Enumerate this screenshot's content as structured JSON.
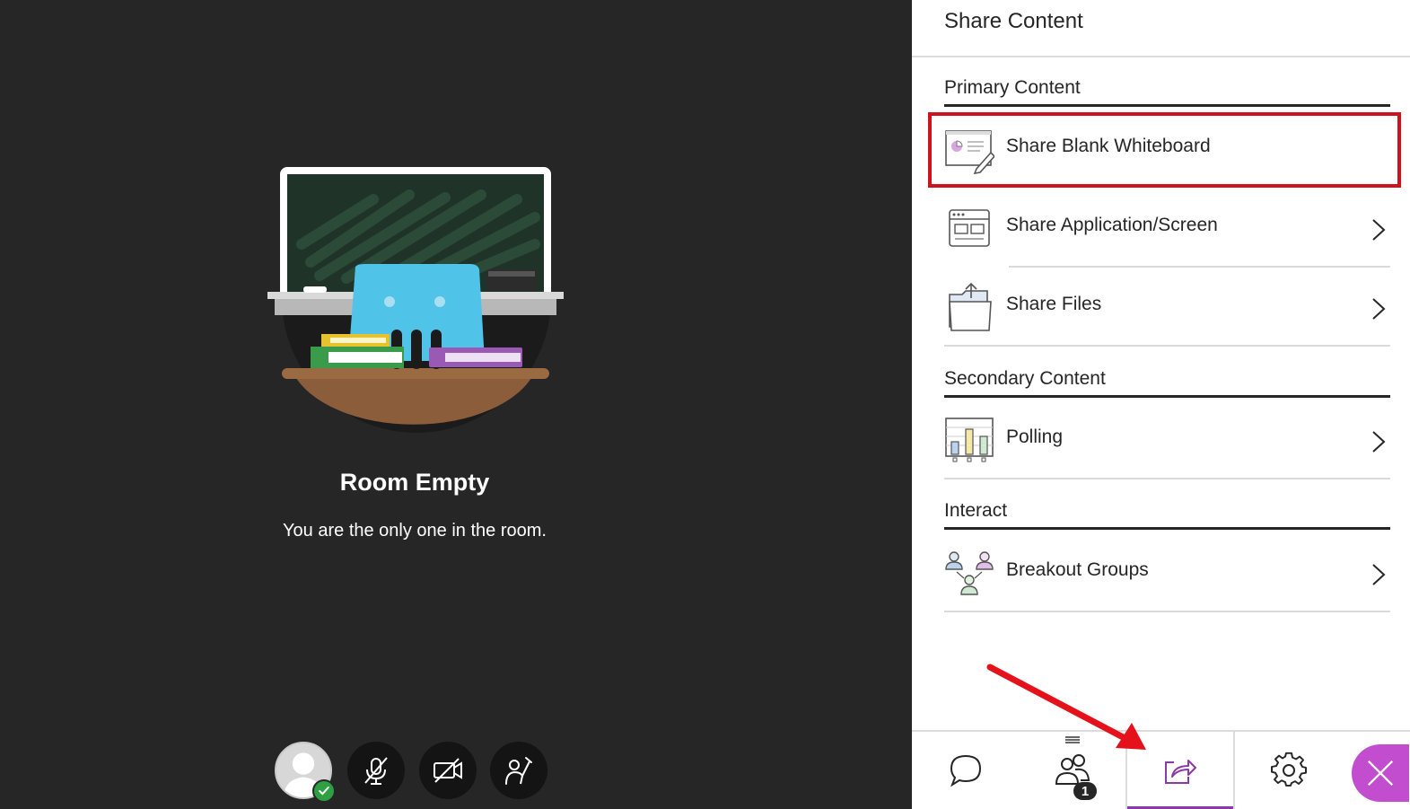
{
  "stage": {
    "title": "Room Empty",
    "subtitle": "You are the only one in the room.",
    "controls": [
      {
        "icon": "avatar-icon",
        "status": "check-icon"
      },
      {
        "icon": "microphone-muted-icon"
      },
      {
        "icon": "camera-off-icon"
      },
      {
        "icon": "raise-hand-icon"
      }
    ]
  },
  "panel": {
    "title": "Share Content",
    "sections": {
      "primary": {
        "heading": "Primary Content",
        "items": [
          {
            "label": "Share Blank Whiteboard",
            "icon": "whiteboard-icon",
            "chevron": false
          },
          {
            "label": "Share Application/Screen",
            "icon": "application-screen-icon",
            "chevron": true
          },
          {
            "label": "Share Files",
            "icon": "files-icon",
            "chevron": true
          }
        ]
      },
      "secondary": {
        "heading": "Secondary Content",
        "items": [
          {
            "label": "Polling",
            "icon": "polling-icon",
            "chevron": true
          }
        ]
      },
      "interact": {
        "heading": "Interact",
        "items": [
          {
            "label": "Breakout Groups",
            "icon": "breakout-groups-icon",
            "chevron": true
          }
        ]
      }
    }
  },
  "bottom_nav": {
    "items": [
      "chat-icon",
      "attendees-icon",
      "share-content-icon",
      "settings-icon"
    ],
    "attendee_count": "1",
    "active": "share-content-icon",
    "close_icon": "close-icon"
  },
  "colors": {
    "accent": "#c34dcf",
    "highlight_box": "#d0121d",
    "stage_bg": "#262626",
    "active_underline": "#8a3aa6"
  }
}
